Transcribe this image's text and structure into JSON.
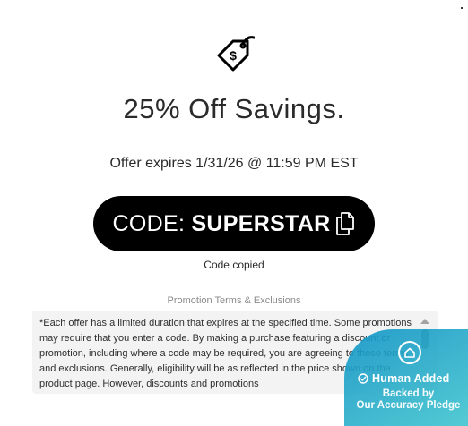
{
  "offer": {
    "headline": "25% Off Savings.",
    "expires": "Offer expires 1/31/26 @ 11:59 PM EST",
    "tag_icon": "price-tag-dollar-icon"
  },
  "code_button": {
    "prefix": "CODE: ",
    "code": "SUPERSTAR",
    "icon": "copy-icon",
    "background": "#000000",
    "text_color": "#ffffff"
  },
  "status": {
    "copied": "Code copied"
  },
  "terms": {
    "title": "Promotion Terms & Exclusions",
    "body": "*Each offer has a limited duration that expires at the specified time. Some promotions may require that you enter a code. By making a purchase featuring a discount or promotion, including where a code may be required, you are agreeing to these terms and exclusions. Generally, eligibility will be as reflected in the price shown on the product page. However, discounts and promotions"
  },
  "badge": {
    "icon": "house-icon",
    "check_icon": "check-circle-icon",
    "title": "Human Added",
    "subtitle_line1": "Backed by",
    "subtitle_line2": "Our Accuracy Pledge",
    "color": "#1fa3c8"
  }
}
